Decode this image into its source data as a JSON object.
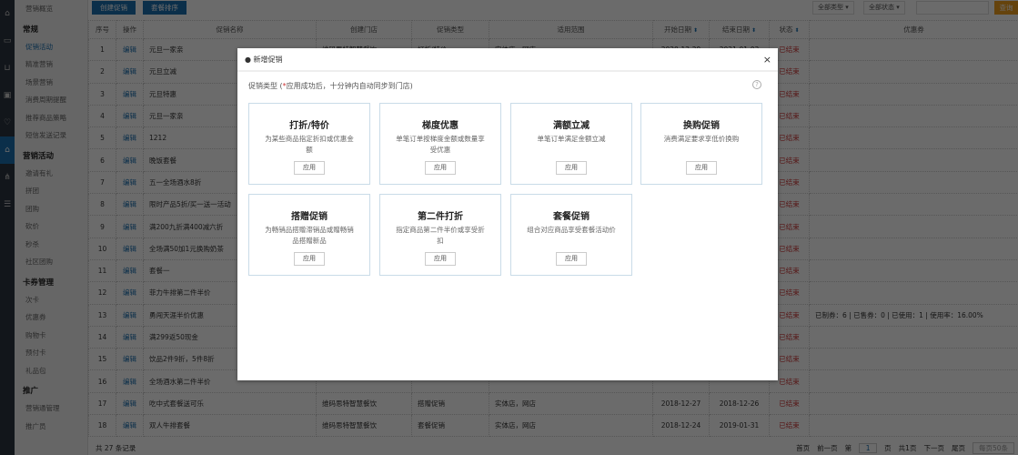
{
  "sidebar": {
    "groups": [
      {
        "label": "",
        "items": [
          "营销概览"
        ]
      },
      {
        "label": "常规",
        "items": [
          "促销活动",
          "精准营销",
          "场景营销",
          "消费周期提醒",
          "推荐商品策略",
          "短信发送记录"
        ]
      },
      {
        "label": "营销活动",
        "items": [
          "邀请有礼",
          "拼团",
          "团购",
          "砍价",
          "秒杀",
          "社区团购"
        ]
      },
      {
        "label": "卡券管理",
        "items": [
          "次卡",
          "优惠券",
          "购物卡",
          "预付卡",
          "礼品包"
        ]
      },
      {
        "label": "推广",
        "items": [
          "营销通管理",
          "推广员"
        ]
      }
    ]
  },
  "toolbar": {
    "create": "创建促销",
    "sort": "套餐排序",
    "type_filter": "全部类型 ▾",
    "status_filter": "全部状态 ▾",
    "query": "查询"
  },
  "table": {
    "headers": [
      "序号",
      "操作",
      "促销名称",
      "创建门店",
      "促销类型",
      "适用范围",
      "开始日期",
      "结束日期",
      "状态",
      "优惠券"
    ],
    "rows": [
      [
        "1",
        "编辑",
        "元旦一家亲",
        "维码思特智慧餐饮",
        "打折/特价",
        "实体店，网店",
        "2020-12-29",
        "2021-01-03",
        "已结束",
        ""
      ],
      [
        "2",
        "编辑",
        "元旦立减",
        "",
        "",
        "",
        "",
        "",
        "已结束",
        ""
      ],
      [
        "3",
        "编辑",
        "元旦特惠",
        "",
        "",
        "",
        "",
        "",
        "已结束",
        ""
      ],
      [
        "4",
        "编辑",
        "元旦一家亲",
        "",
        "",
        "",
        "",
        "",
        "已结束",
        ""
      ],
      [
        "5",
        "编辑",
        "1212",
        "",
        "",
        "",
        "",
        "",
        "已结束",
        ""
      ],
      [
        "6",
        "编辑",
        "晚饭套餐",
        "",
        "",
        "",
        "",
        "",
        "已结束",
        ""
      ],
      [
        "7",
        "编辑",
        "五一全场酒水8折",
        "",
        "",
        "",
        "",
        "",
        "已结束",
        ""
      ],
      [
        "8",
        "编辑",
        "限时产品5折/买一送一活动",
        "",
        "",
        "",
        "",
        "",
        "已结束",
        ""
      ],
      [
        "9",
        "编辑",
        "满200九折满400减六折",
        "",
        "",
        "",
        "",
        "",
        "已结束",
        ""
      ],
      [
        "10",
        "编辑",
        "全场满50加1元换购奶茶",
        "",
        "",
        "",
        "",
        "",
        "已结束",
        ""
      ],
      [
        "11",
        "编辑",
        "套餐一",
        "",
        "",
        "",
        "",
        "",
        "已结束",
        ""
      ],
      [
        "12",
        "编辑",
        "菲力牛排第二件半价",
        "",
        "",
        "",
        "",
        "",
        "已结束",
        ""
      ],
      [
        "13",
        "编辑",
        "勇闯天涯半价优惠",
        "",
        "",
        "",
        "",
        "",
        "已结束",
        "已制券：6 | 已售券：0 | 已使用：1 | 使用率：16.00%"
      ],
      [
        "14",
        "编辑",
        "满299返50现金",
        "",
        "",
        "",
        "",
        "",
        "已结束",
        ""
      ],
      [
        "15",
        "编辑",
        "饮品2件9折，5件8折",
        "",
        "",
        "",
        "",
        "",
        "已结束",
        ""
      ],
      [
        "16",
        "编辑",
        "全场酒水第二件半价",
        "",
        "",
        "",
        "",
        "",
        "已结束",
        ""
      ],
      [
        "17",
        "编辑",
        "吃中式套餐送可乐",
        "维码思特智慧餐饮",
        "搭赠促销",
        "实体店，网店",
        "2018-12-27",
        "2018-12-26",
        "已结束",
        ""
      ],
      [
        "18",
        "编辑",
        "双人牛排套餐",
        "维码思特智慧餐饮",
        "套餐促销",
        "实体店，网店",
        "2018-12-24",
        "2019-01-31",
        "已结束",
        ""
      ]
    ]
  },
  "footer": {
    "total": "共 27 条记录",
    "first": "首页",
    "prev": "前一页",
    "page_pre": "第",
    "page": "1",
    "page_post": "页",
    "pages": "共1页",
    "next": "下一页",
    "last": "尾页",
    "per_page": "每页50条"
  },
  "modal": {
    "title": "新增促销",
    "subtitle_pre": "促销类型 (",
    "subtitle_req": "*",
    "subtitle_post": "应用成功后，十分钟内自动同步到门店)",
    "help": "?",
    "close": "×",
    "cards": [
      {
        "title": "打折/特价",
        "desc": "为某些商品指定折扣或优惠金额",
        "apply": "应用"
      },
      {
        "title": "梯度优惠",
        "desc": "单笔订单按梯度金额或数量享受优惠",
        "apply": "应用"
      },
      {
        "title": "满额立减",
        "desc": "单笔订单满足金额立减",
        "apply": "应用"
      },
      {
        "title": "换购促销",
        "desc": "消费满足要求享低价换购",
        "apply": "应用"
      },
      {
        "title": "搭赠促销",
        "desc": "为畅销品搭赠滞销品或赠畅销品搭赠新品",
        "apply": "应用"
      },
      {
        "title": "第二件打折",
        "desc": "指定商品第二件半价或享受折扣",
        "apply": "应用"
      },
      {
        "title": "套餐促销",
        "desc": "组合对应商品享受套餐活动价",
        "apply": "应用"
      }
    ]
  }
}
